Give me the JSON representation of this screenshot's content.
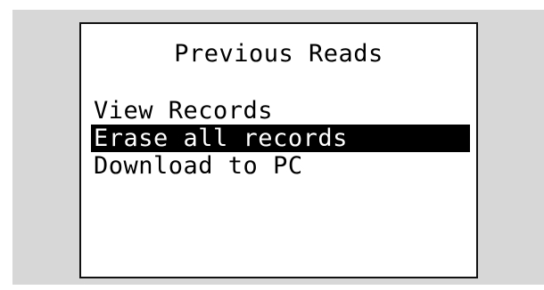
{
  "screen": {
    "title": "Previous Reads",
    "menu": [
      {
        "label": "View Records",
        "selected": false
      },
      {
        "label": "Erase all records",
        "selected": true
      },
      {
        "label": "Download to PC",
        "selected": false
      }
    ]
  },
  "colors": {
    "bezel": "#d7d7d7",
    "screen_background": "#ffffff",
    "highlight": "#000000",
    "highlight_text": "#ffffff"
  }
}
